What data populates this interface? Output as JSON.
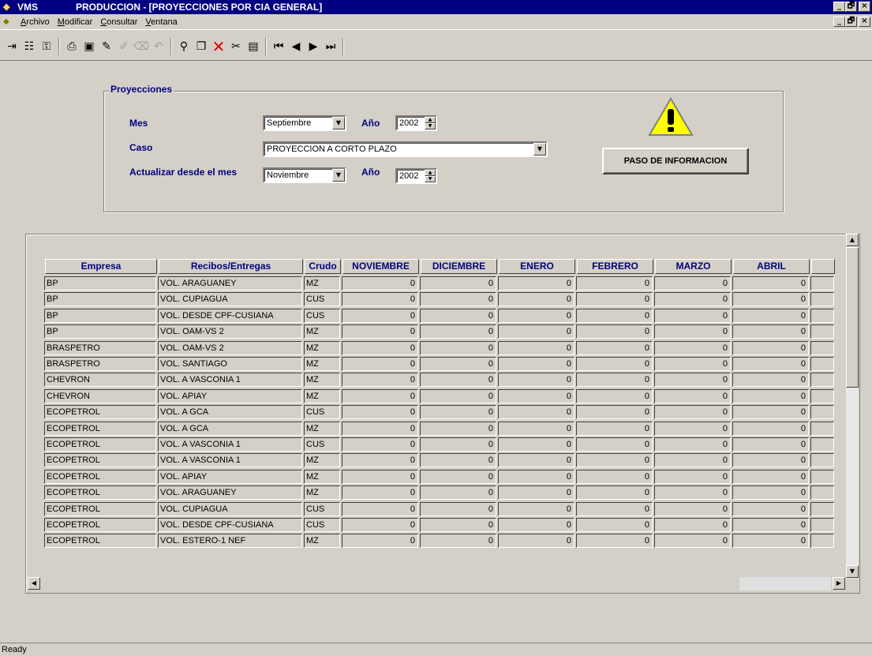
{
  "window": {
    "app_name": "VMS",
    "title": "PRODUCCION - [PROYECCIONES POR CIA GENERAL]",
    "min_label": "_",
    "max_label": "🗗",
    "close_label": "×"
  },
  "menu": {
    "items": [
      "Archivo",
      "Modificar",
      "Consultar",
      "Ventana"
    ]
  },
  "toolbar": {
    "icons": [
      "enter-icon",
      "tree-icon",
      "key-icon",
      "print-icon",
      "save-icon",
      "pen-icon",
      "eraser-icon",
      "clear-icon",
      "undo-icon",
      "find-icon",
      "copy-icon",
      "delete-icon",
      "paste-icon",
      "details-icon",
      "first-record-icon",
      "prev-record-icon",
      "next-record-icon",
      "last-record-icon"
    ],
    "delete_glyph": "✕"
  },
  "form": {
    "group_title": "Proyecciones",
    "mes_label": "Mes",
    "mes_value": "Septiembre",
    "anio_label": "Año",
    "anio_value": "2002",
    "caso_label": "Caso",
    "caso_value": "PROYECCION A CORTO PLAZO",
    "actualizar_label": "Actualizar desde el mes",
    "actualizar_mes_value": "Noviembre",
    "anio2_label": "Año",
    "anio2_value": "2002",
    "button_label": "PASO DE INFORMACION"
  },
  "grid": {
    "headers": [
      "Empresa",
      "Recibos/Entregas",
      "Crudo",
      "NOVIEMBRE",
      "DICIEMBRE",
      "ENERO",
      "FEBRERO",
      "MARZO",
      "ABRIL"
    ],
    "rows": [
      [
        "BP",
        "VOL. ARAGUANEY",
        "MZ",
        "0",
        "0",
        "0",
        "0",
        "0",
        "0"
      ],
      [
        "BP",
        "VOL. CUPIAGUA",
        "CUS",
        "0",
        "0",
        "0",
        "0",
        "0",
        "0"
      ],
      [
        "BP",
        "VOL. DESDE CPF-CUSIANA",
        "CUS",
        "0",
        "0",
        "0",
        "0",
        "0",
        "0"
      ],
      [
        "BP",
        "VOL. OAM-VS 2",
        "MZ",
        "0",
        "0",
        "0",
        "0",
        "0",
        "0"
      ],
      [
        "BRASPETRO",
        "VOL. OAM-VS 2",
        "MZ",
        "0",
        "0",
        "0",
        "0",
        "0",
        "0"
      ],
      [
        "BRASPETRO",
        "VOL. SANTIAGO",
        "MZ",
        "0",
        "0",
        "0",
        "0",
        "0",
        "0"
      ],
      [
        "CHEVRON",
        "VOL. A VASCONIA 1",
        "MZ",
        "0",
        "0",
        "0",
        "0",
        "0",
        "0"
      ],
      [
        "CHEVRON",
        "VOL. APIAY",
        "MZ",
        "0",
        "0",
        "0",
        "0",
        "0",
        "0"
      ],
      [
        "ECOPETROL",
        "VOL. A GCA",
        "CUS",
        "0",
        "0",
        "0",
        "0",
        "0",
        "0"
      ],
      [
        "ECOPETROL",
        "VOL. A GCA",
        "MZ",
        "0",
        "0",
        "0",
        "0",
        "0",
        "0"
      ],
      [
        "ECOPETROL",
        "VOL. A VASCONIA 1",
        "CUS",
        "0",
        "0",
        "0",
        "0",
        "0",
        "0"
      ],
      [
        "ECOPETROL",
        "VOL. A VASCONIA 1",
        "MZ",
        "0",
        "0",
        "0",
        "0",
        "0",
        "0"
      ],
      [
        "ECOPETROL",
        "VOL. APIAY",
        "MZ",
        "0",
        "0",
        "0",
        "0",
        "0",
        "0"
      ],
      [
        "ECOPETROL",
        "VOL. ARAGUANEY",
        "MZ",
        "0",
        "0",
        "0",
        "0",
        "0",
        "0"
      ],
      [
        "ECOPETROL",
        "VOL. CUPIAGUA",
        "CUS",
        "0",
        "0",
        "0",
        "0",
        "0",
        "0"
      ],
      [
        "ECOPETROL",
        "VOL. DESDE CPF-CUSIANA",
        "CUS",
        "0",
        "0",
        "0",
        "0",
        "0",
        "0"
      ],
      [
        "ECOPETROL",
        "VOL. ESTERO-1 NEF",
        "MZ",
        "0",
        "0",
        "0",
        "0",
        "0",
        "0"
      ]
    ]
  },
  "status": {
    "text": "Ready"
  },
  "colors": {
    "title_bar": "#000080",
    "label_text": "#000080",
    "face": "#d4d0c8"
  }
}
